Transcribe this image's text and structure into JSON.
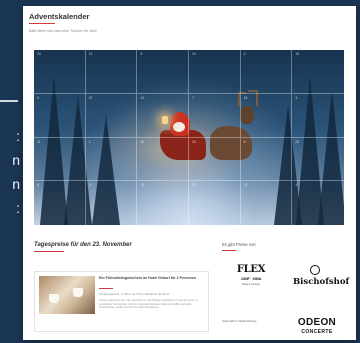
{
  "page": {
    "title": "Adventskalender",
    "subtitle": "Bald öffnet sich das neue Türchen für dich!"
  },
  "calendar": {
    "doors": [
      {
        "n": "24"
      },
      {
        "n": "12"
      },
      {
        "n": "5"
      },
      {
        "n": "19"
      },
      {
        "n": "2"
      },
      {
        "n": "15"
      },
      {
        "n": "9"
      },
      {
        "n": "22"
      },
      {
        "n": "14"
      },
      {
        "n": "7"
      },
      {
        "n": "18"
      },
      {
        "n": "3"
      },
      {
        "n": "11"
      },
      {
        "n": "1"
      },
      {
        "n": "20"
      },
      {
        "n": "16"
      },
      {
        "n": "8"
      },
      {
        "n": "23"
      },
      {
        "n": "6"
      },
      {
        "n": "17"
      },
      {
        "n": "10"
      },
      {
        "n": "21"
      },
      {
        "n": "13"
      },
      {
        "n": "4"
      }
    ]
  },
  "prizes": {
    "heading": "Tagespreise für den 23. November",
    "card": {
      "title": "Ein Frühstücksgutschein im Hotel Geburt für 2 Personen",
      "meta": "Anzahl Gewinne: 1  |  Wert: ca. 60 €  |  Teilnahme bis 23.11.",
      "desc": "Starte entspannt in den Tag: Genieße ein reichhaltiges Frühstück für zwei Personen in gemütlicher Atmosphäre. Frische regionale Produkte, duftender Kaffee und süße Köstlichkeiten warten auf dich und deine Begleitung."
    }
  },
  "sponsors": {
    "heading": "Es gibt Preise von",
    "flex_name": "FLEX",
    "flex_sub": "JUNF · KIMA",
    "flex_sub2": "Mode & Lifestyle",
    "bischof_name": "Bischofshof",
    "small_names": "Hotel Geburt  |  Stadtmarketing",
    "odeon_name": "ODEON",
    "odeon_sub": "CONCERTE"
  },
  "colors": {
    "accent": "#d23b3b",
    "background": "#1b3554"
  }
}
